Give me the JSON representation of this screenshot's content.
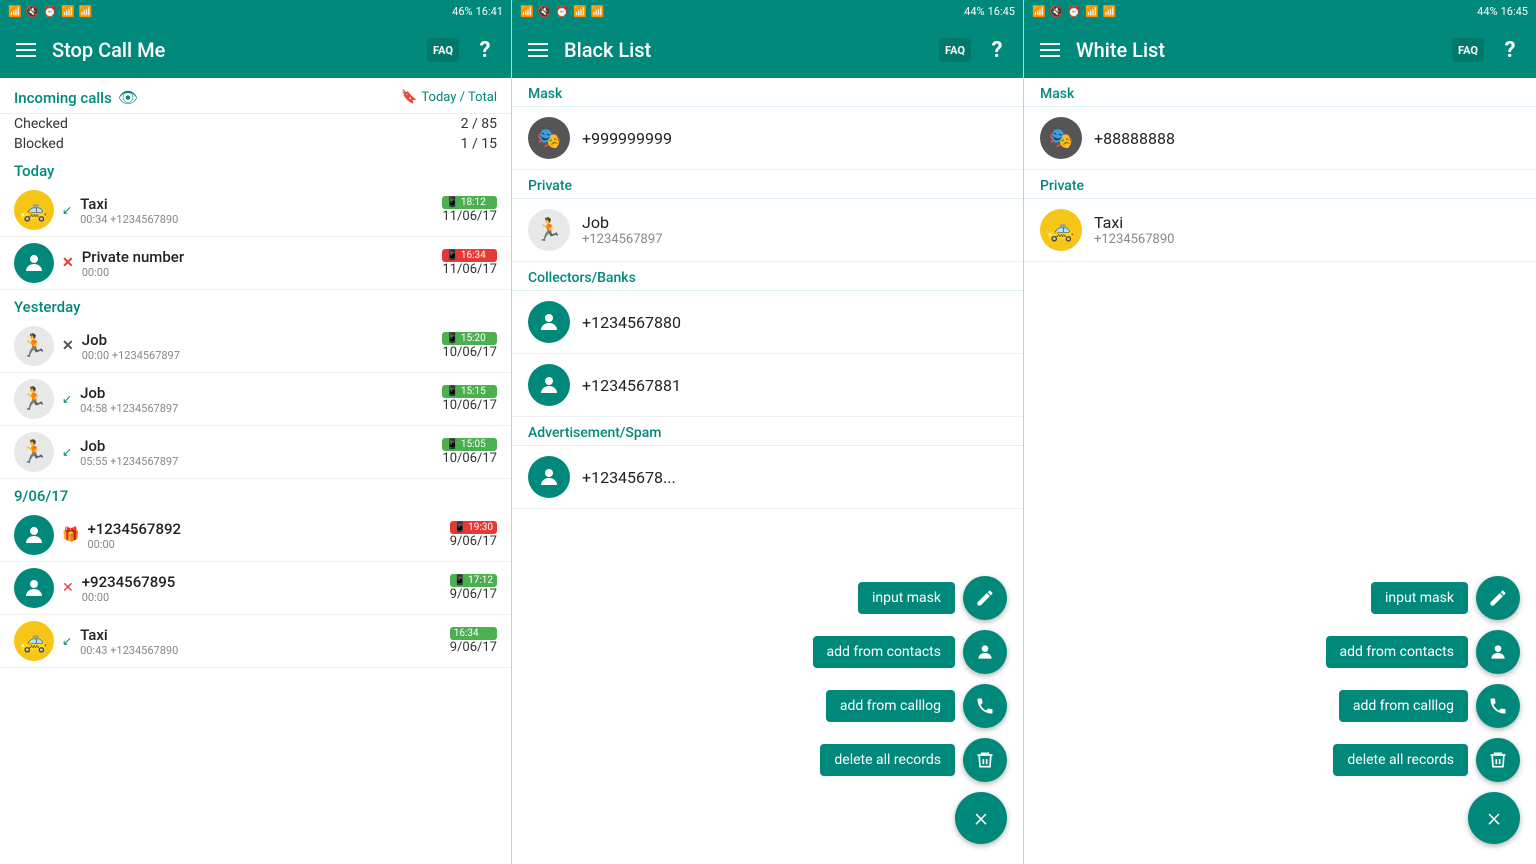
{
  "screen1": {
    "statusBar": {
      "left": "🔵",
      "battery": "46%",
      "time": "16:41",
      "icons": [
        "BT",
        "🔇",
        "⏰",
        "📶"
      ]
    },
    "title": "Stop Call Me",
    "incomingLabel": "Incoming calls",
    "todayTotal": "Today / Total",
    "checked": "Checked",
    "checkedVal": "2 / 85",
    "blocked": "Blocked",
    "blockedVal": "1 / 15",
    "sections": [
      {
        "label": "Today",
        "calls": [
          {
            "name": "Taxi",
            "sub": "00:34  +1234567890",
            "time": "18:12",
            "date": "11/06/17",
            "avatar": "taxi",
            "iconType": "incoming-green",
            "blocked": false
          },
          {
            "name": "Private number",
            "sub": "00:00",
            "time": "16:34",
            "date": "11/06/17",
            "avatar": "person",
            "iconType": "x-red",
            "blocked": false
          }
        ]
      },
      {
        "label": "Yesterday",
        "calls": [
          {
            "name": "Job",
            "sub": "00:00  +1234567897",
            "time": "15:20",
            "date": "10/06/17",
            "avatar": "job",
            "iconType": "x-dark",
            "blocked": false
          },
          {
            "name": "Job",
            "sub": "04:58  +1234567897",
            "time": "15:15",
            "date": "10/06/17",
            "avatar": "job",
            "iconType": "incoming-green",
            "blocked": false
          },
          {
            "name": "Job",
            "sub": "05:55  +1234567897",
            "time": "15:05",
            "date": "10/06/17",
            "avatar": "job",
            "iconType": "incoming-green",
            "blocked": false
          }
        ]
      },
      {
        "label": "9/06/17",
        "calls": [
          {
            "name": "+1234567892",
            "sub": "00:00",
            "time": "19:30",
            "date": "9/06/17",
            "avatar": "person-gift",
            "iconType": "badge-red",
            "blocked": true
          },
          {
            "name": "+9234567895",
            "sub": "00:00",
            "time": "17:12",
            "date": "9/06/17",
            "avatar": "person-globe",
            "iconType": "x-red2",
            "blocked": false
          },
          {
            "name": "Taxi",
            "sub": "00:43  +1234567890",
            "time": "16:34",
            "date": "9/06/17",
            "avatar": "taxi",
            "iconType": "incoming-green",
            "blocked": false
          }
        ]
      }
    ]
  },
  "screen2": {
    "statusBar": {
      "battery": "44%",
      "time": "16:45"
    },
    "title": "Black List",
    "sections": [
      {
        "label": "Mask",
        "items": [
          {
            "number": "+999999999",
            "sub": "",
            "avatar": "mask"
          }
        ]
      },
      {
        "label": "Private",
        "items": [
          {
            "number": "Job",
            "sub": "+1234567897",
            "avatar": "job"
          }
        ]
      },
      {
        "label": "Collectors/Banks",
        "items": [
          {
            "number": "+1234567880",
            "sub": "",
            "avatar": "person"
          },
          {
            "number": "+1234567881",
            "sub": "",
            "avatar": "person"
          }
        ]
      },
      {
        "label": "Advertisement/Spam",
        "items": [
          {
            "number": "+12345678...",
            "sub": "",
            "avatar": "person"
          }
        ]
      }
    ],
    "fab": {
      "inputMask": "input mask",
      "addFromContacts": "add from contacts",
      "addFromCalllog": "add from calllog",
      "deleteAllRecords": "delete all records",
      "close": "×"
    }
  },
  "screen3": {
    "statusBar": {
      "battery": "44%",
      "time": "16:45"
    },
    "title": "White List",
    "sections": [
      {
        "label": "Mask",
        "items": [
          {
            "number": "+88888888",
            "sub": "",
            "avatar": "mask"
          }
        ]
      },
      {
        "label": "Private",
        "items": [
          {
            "number": "Taxi",
            "sub": "+1234567890",
            "avatar": "taxi"
          }
        ]
      }
    ],
    "fab": {
      "inputMask": "input mask",
      "addFromContacts": "add from contacts",
      "addFromCalllog": "add from calllog",
      "deleteAllRecords": "delete all records",
      "close": "×"
    }
  }
}
